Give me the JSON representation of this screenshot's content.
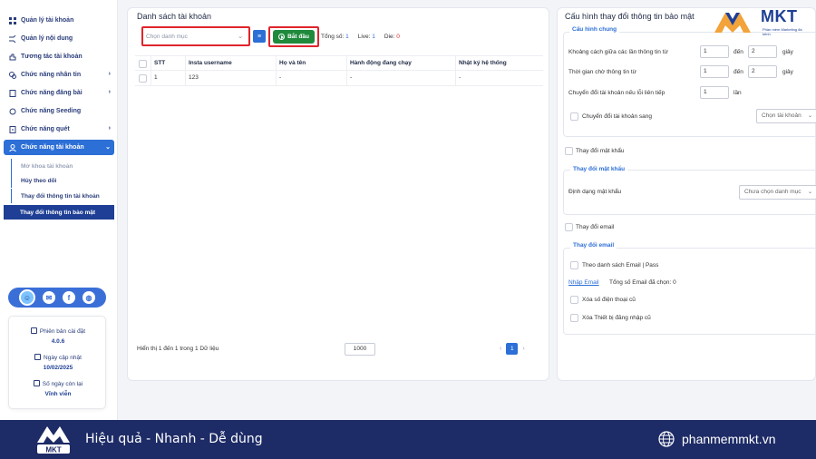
{
  "sidebar": {
    "items": [
      {
        "label": "Quản lý tài khoản",
        "icon": "grid-icon"
      },
      {
        "label": "Quản lý nội dung",
        "icon": "shuffle-icon"
      },
      {
        "label": "Tương tác tài khoản",
        "icon": "hand-icon"
      },
      {
        "label": "Chức năng nhân tin",
        "icon": "chat-icon"
      },
      {
        "label": "Chức năng đăng bài",
        "icon": "document-icon"
      },
      {
        "label": "Chức năng Seeding",
        "icon": "refresh-icon"
      },
      {
        "label": "Chức năng quét",
        "icon": "scan-icon"
      },
      {
        "label": "Chức năng tài khoản",
        "icon": "user-icon"
      }
    ],
    "sub_items": [
      {
        "label": "Mở khoa tài khoản"
      },
      {
        "label": "Hủy theo dõi"
      },
      {
        "label": "Thay đổi thông tin tài khoản"
      },
      {
        "label": "Thay đổi thông tin bảo mật"
      }
    ],
    "info": {
      "version_label": "Phiên bản cài đặt",
      "version": "4.0.6",
      "update_label": "Ngày cập nhật",
      "update_date": "10/02/2025",
      "days_label": "Số ngày còn lại",
      "days_value": "Vĩnh viễn"
    }
  },
  "main": {
    "title": "Danh sách tài khoản",
    "select_placeholder": "Chọn danh mục",
    "start_label": "Bắt đầu",
    "stats": {
      "total_label": "Tổng số:",
      "total": "1",
      "live_label": "Live:",
      "live": "1",
      "die_label": "Die:",
      "die": "0"
    },
    "columns": [
      "STT",
      "Insta username",
      "Họ và tên",
      "Hành động đang chạy",
      "Nhật ký hệ thống"
    ],
    "rows": [
      [
        "1",
        "123",
        "-",
        "-",
        "-"
      ]
    ],
    "footer_text": "Hiển thị 1 đến 1 trong 1 Dữ liệu",
    "page_size": "1000",
    "current_page": "1"
  },
  "config": {
    "title": "Cấu hình thay đổi thông tin bảo mật",
    "general_label": "Cấu hình chung",
    "delay_label": "Khoảng cách giữa các lần thông tin từ",
    "delay_from": "1",
    "delay_to": "2",
    "wait_label": "Thời gian chờ thông tin từ",
    "wait_from": "1",
    "wait_to": "2",
    "to_label": "đến",
    "unit_sec": "giây",
    "switch_label": "Chuyển đổi tài khoản nếu lỗi liên tiếp",
    "switch_value": "1",
    "unit_times": "lần",
    "switch_check_label": "Chuyển đổi tài khoản sang",
    "switch_dropdown": "Chọn tài khoản",
    "change_pw_check": "Thay đổi mật khẩu",
    "change_pw_group": "Thay đổi mật khẩu",
    "pw_format_label": "Định dạng mật khẩu",
    "pw_format_dropdown": "Chưa chọn danh mục",
    "change_email_check": "Thay đổi email",
    "change_email_group": "Thay đổi email",
    "email_list_label": "Theo danh sách Email | Pass",
    "import_email_link": "Nhập Email",
    "email_total_label": "Tổng số Email đã chọn: 0",
    "remove_phone_label": "Xóa số điện thoại cũ",
    "remove_device_label": "Xóa Thiết bị đăng nhập cũ"
  },
  "logo": {
    "brand": "MKT",
    "tagline": "Phần mềm Marketing đa kênh"
  },
  "banner": {
    "slogan": "Hiệu quả - Nhanh - Dễ dùng",
    "website": "phanmemmkt.vn"
  },
  "colors": {
    "primary": "#2c6fd6",
    "navy": "#1d2b66",
    "start_green": "#1f8a3c",
    "highlight_red": "#e0242c"
  }
}
